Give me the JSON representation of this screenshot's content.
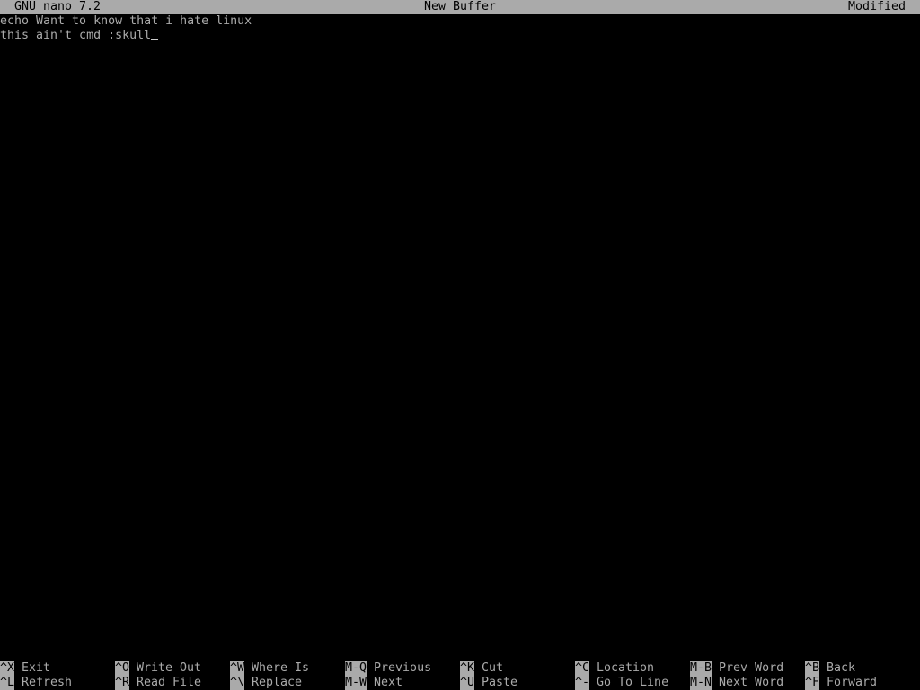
{
  "titlebar": {
    "app": "GNU nano 7.2",
    "filename": "New Buffer",
    "status": "Modified"
  },
  "editor": {
    "lines": [
      "echo Want to know that i hate linux",
      "this ain't cmd :skull"
    ]
  },
  "shortcuts": {
    "row1": [
      {
        "key": "^X",
        "label": "Exit"
      },
      {
        "key": "^O",
        "label": "Write Out"
      },
      {
        "key": "^W",
        "label": "Where Is"
      },
      {
        "key": "M-Q",
        "label": "Previous"
      },
      {
        "key": "^K",
        "label": "Cut"
      },
      {
        "key": "^C",
        "label": "Location"
      },
      {
        "key": "M-B",
        "label": "Prev Word"
      },
      {
        "key": "^B",
        "label": "Back"
      }
    ],
    "row2": [
      {
        "key": "^L",
        "label": "Refresh"
      },
      {
        "key": "^R",
        "label": "Read File"
      },
      {
        "key": "^\\",
        "label": "Replace"
      },
      {
        "key": "M-W",
        "label": "Next"
      },
      {
        "key": "^U",
        "label": "Paste"
      },
      {
        "key": "^-",
        "label": "Go To Line"
      },
      {
        "key": "M-N",
        "label": "Next Word"
      },
      {
        "key": "^F",
        "label": "Forward"
      }
    ]
  },
  "colors": {
    "background": "#000000",
    "foreground": "#aaaaaa",
    "highlight": "#aaaaaa"
  }
}
